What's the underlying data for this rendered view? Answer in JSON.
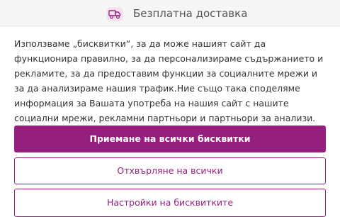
{
  "promo": {
    "icon": "delivery-truck-icon",
    "text": "Безплатна доставка"
  },
  "cookie_banner": {
    "message": "Използваме „бисквитки“, за да може нашият сайт да функционира правилно, за да персонализираме съдържанието и рекламите, за да предоставим функции за социалните мрежи и за да анализираме нашия трафик.Ние също така споделяме информация за Вашата употреба на нашия сайт с нашите социални мрежи, рекламни партньори и партньори за анализи.",
    "accept_all_label": "Приемане на всички бисквитки",
    "reject_all_label": "Отхвърляне на всички",
    "settings_label": "Настройки на бисквитките"
  },
  "colors": {
    "accent": "#951f7f",
    "background": "#ffffff",
    "strip_background": "#f5f5f5",
    "text": "#333333"
  }
}
